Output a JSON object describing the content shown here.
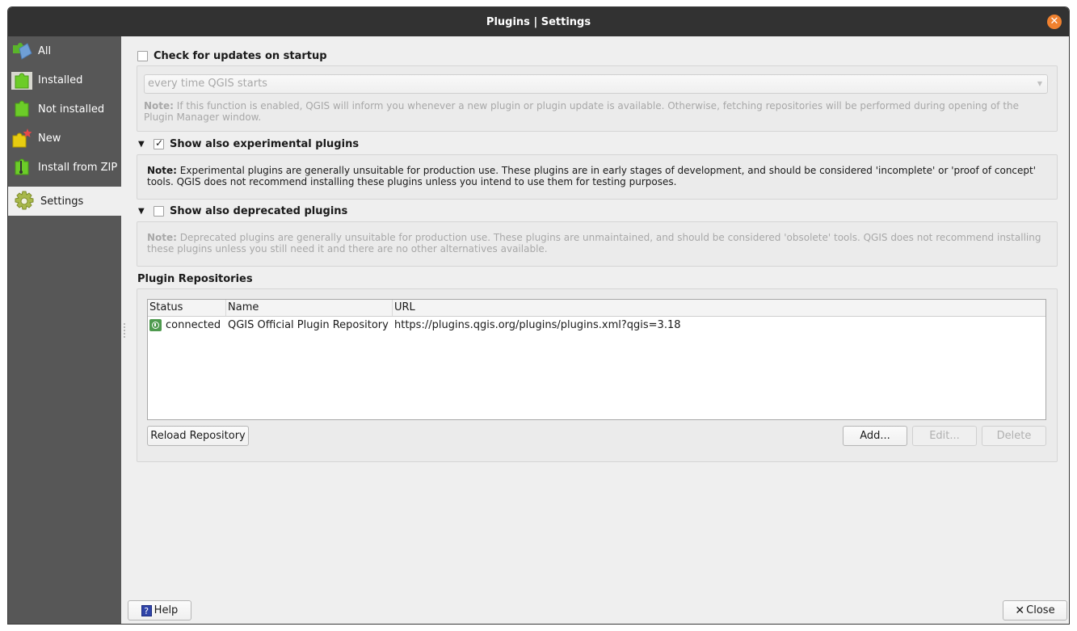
{
  "window": {
    "title": "Plugins | Settings"
  },
  "sidebar": {
    "items": [
      {
        "label": "All",
        "icon": "puzzle-all-icon"
      },
      {
        "label": "Installed",
        "icon": "puzzle-installed-icon"
      },
      {
        "label": "Not installed",
        "icon": "puzzle-not-installed-icon"
      },
      {
        "label": "New",
        "icon": "puzzle-new-icon"
      },
      {
        "label": "Install from ZIP",
        "icon": "puzzle-zip-icon"
      },
      {
        "label": "Settings",
        "icon": "gear-icon",
        "active": true
      }
    ]
  },
  "settings": {
    "check_updates": {
      "label": "Check for updates on startup",
      "checked": false,
      "frequency_value": "every time QGIS starts",
      "note_prefix": "Note:",
      "note_text": " If this function is enabled, QGIS will inform you whenever a new plugin or plugin update is available. Otherwise, fetching repositories will be performed during opening of the Plugin Manager window."
    },
    "experimental": {
      "label": "Show also experimental plugins",
      "checked": true,
      "note_prefix": "Note:",
      "note_text": " Experimental plugins are generally unsuitable for production use. These plugins are in early stages of development, and should be considered 'incomplete' or 'proof of concept' tools. QGIS does not recommend installing these plugins unless you intend to use them for testing purposes."
    },
    "deprecated": {
      "label": "Show also deprecated plugins",
      "checked": false,
      "note_prefix": "Note:",
      "note_text": " Deprecated plugins are generally unsuitable for production use. These plugins are unmaintained, and should be considered 'obsolete' tools. QGIS does not recommend installing these plugins unless you still need it and there are no other alternatives available."
    },
    "repositories": {
      "heading": "Plugin Repositories",
      "columns": [
        "Status",
        "Name",
        "URL"
      ],
      "rows": [
        {
          "status": "connected",
          "name": "QGIS Official Plugin Repository",
          "url": "https://plugins.qgis.org/plugins/plugins.xml?qgis=3.18"
        }
      ],
      "reload_label": "Reload Repository",
      "add_label": "Add...",
      "edit_label": "Edit...",
      "delete_label": "Delete"
    }
  },
  "footer": {
    "help_label": "Help",
    "close_label": "Close"
  }
}
